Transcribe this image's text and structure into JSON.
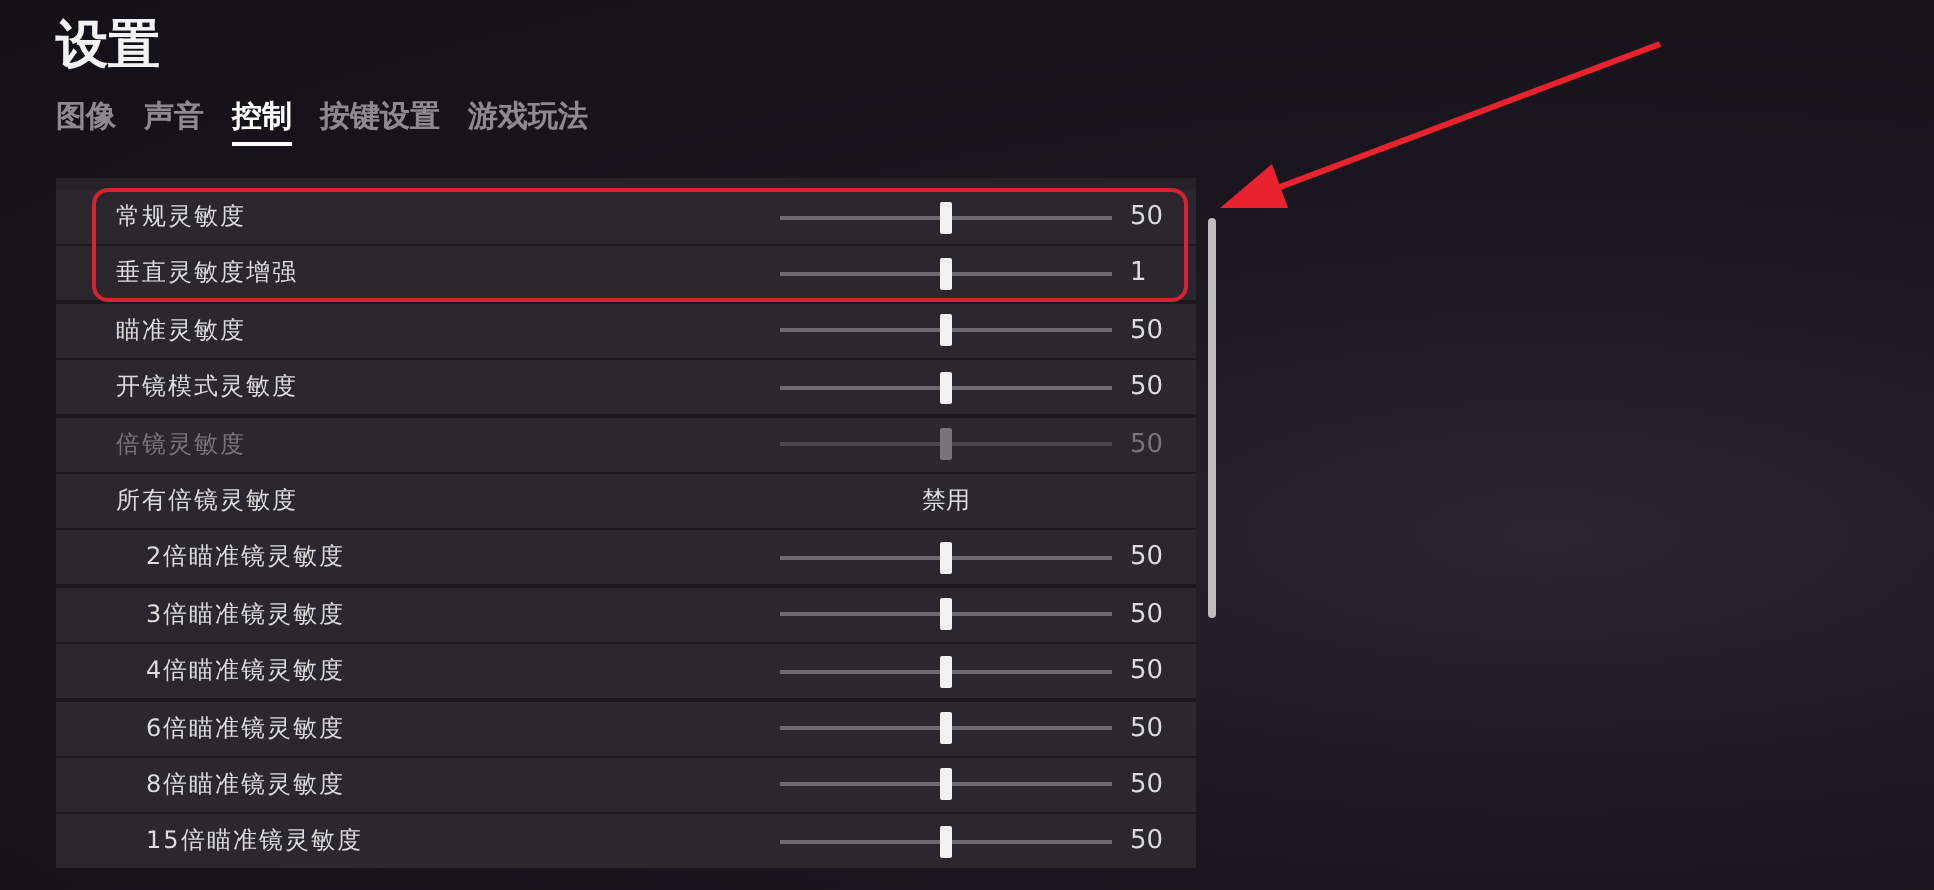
{
  "title": "设置",
  "tabs": [
    {
      "label": "图像",
      "selected": false
    },
    {
      "label": "声音",
      "selected": false
    },
    {
      "label": "控制",
      "selected": true
    },
    {
      "label": "按键设置",
      "selected": false
    },
    {
      "label": "游戏玩法",
      "selected": false
    }
  ],
  "settings": [
    {
      "kind": "slider",
      "label": "常规灵敏度",
      "level": 0.5,
      "reading": "50",
      "disabled": false,
      "highlighted": true
    },
    {
      "kind": "slider",
      "label": "垂直灵敏度增强",
      "level": 0.5,
      "reading": "1",
      "disabled": false,
      "highlighted": true
    },
    {
      "kind": "slider",
      "label": "瞄准灵敏度",
      "level": 0.5,
      "reading": "50",
      "disabled": false,
      "highlighted": false
    },
    {
      "kind": "slider",
      "label": "开镜模式灵敏度",
      "level": 0.5,
      "reading": "50",
      "disabled": false,
      "highlighted": false
    },
    {
      "kind": "slider",
      "label": "倍镜灵敏度",
      "level": 0.5,
      "reading": "50",
      "disabled": true,
      "highlighted": false
    },
    {
      "kind": "option",
      "label": "所有倍镜灵敏度",
      "value": "禁用",
      "disabled": false,
      "highlighted": false,
      "children": [
        {
          "kind": "slider",
          "label": "2倍瞄准镜灵敏度",
          "level": 0.5,
          "reading": "50",
          "disabled": false
        },
        {
          "kind": "slider",
          "label": "3倍瞄准镜灵敏度",
          "level": 0.5,
          "reading": "50",
          "disabled": false
        },
        {
          "kind": "slider",
          "label": "4倍瞄准镜灵敏度",
          "level": 0.5,
          "reading": "50",
          "disabled": false
        },
        {
          "kind": "slider",
          "label": "6倍瞄准镜灵敏度",
          "level": 0.5,
          "reading": "50",
          "disabled": false
        },
        {
          "kind": "slider",
          "label": "8倍瞄准镜灵敏度",
          "level": 0.5,
          "reading": "50",
          "disabled": false
        },
        {
          "kind": "slider",
          "label": "15倍瞄准镜灵敏度",
          "level": 0.5,
          "reading": "50",
          "disabled": false
        }
      ]
    }
  ]
}
